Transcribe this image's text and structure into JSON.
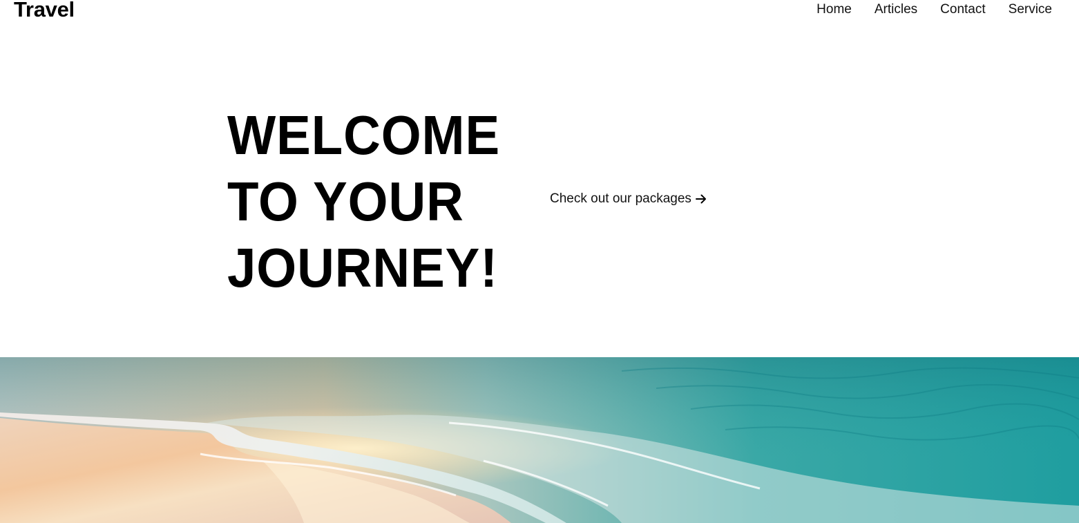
{
  "header": {
    "brand": "Travel",
    "nav": [
      {
        "label": "Home"
      },
      {
        "label": "Articles"
      },
      {
        "label": "Contact"
      },
      {
        "label": "Service"
      }
    ]
  },
  "hero": {
    "title_lines": [
      "WELCOME",
      "TO YOUR",
      "JOURNEY!"
    ],
    "cta_label": "Check out our packages",
    "cta_icon": "arrow-right-icon"
  },
  "banner": {
    "image": "beach-waves-sunset-photo",
    "colors": {
      "sea": "#1f9ea0",
      "sea_light": "#7fc9c4",
      "sand": "#f1cfae",
      "foam": "#f4f1ee",
      "sun_glint": "#fce2b0"
    }
  }
}
